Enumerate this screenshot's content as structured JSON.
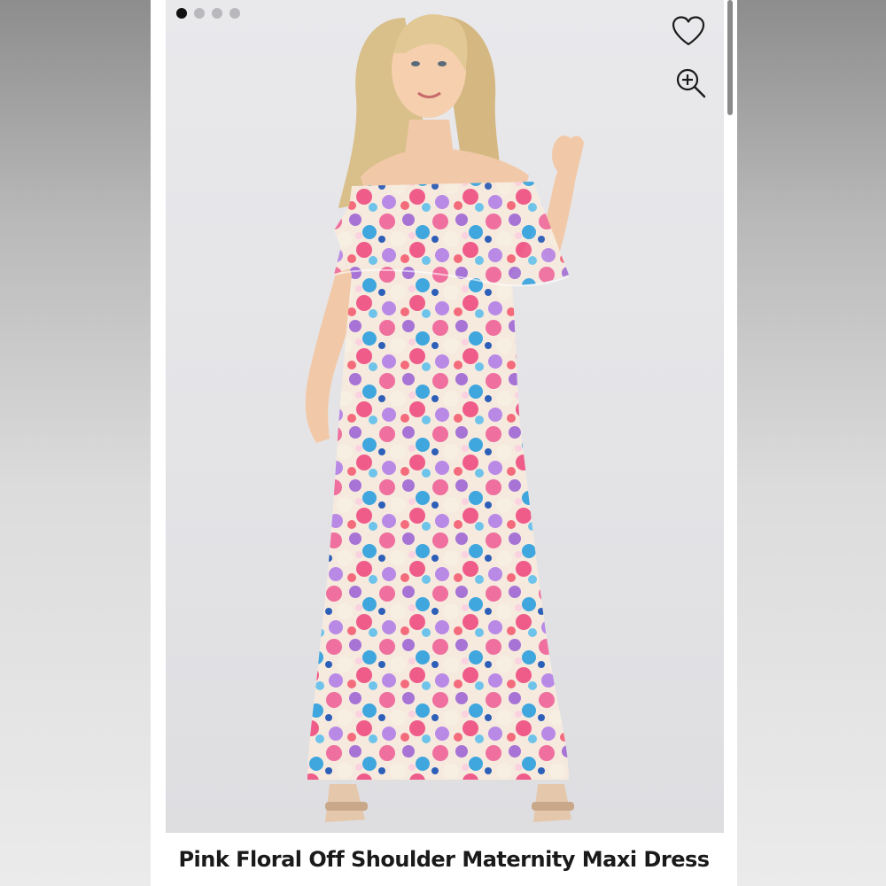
{
  "product": {
    "title": "Pink Floral Off Shoulder Maternity Maxi Dress",
    "image_description_icon": "model-photo"
  },
  "carousel": {
    "total_dots": 4,
    "active_index": 0
  },
  "actions": {
    "favorite_icon": "heart-icon",
    "zoom_icon": "zoom-in-icon"
  },
  "colors": {
    "dress_pink": "#ef6f9e",
    "dress_purple": "#a774d6",
    "dress_blue": "#3fa6de",
    "dress_cream": "#f7efe2",
    "background": "#e6e6e9"
  }
}
